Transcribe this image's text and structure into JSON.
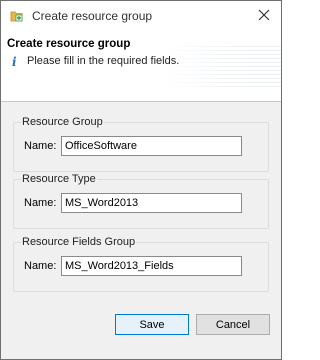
{
  "window": {
    "title": "Create resource group"
  },
  "header": {
    "title": "Create resource group",
    "message": "Please fill in the required fields.",
    "info_icon": "i"
  },
  "groups": [
    {
      "legend": "Resource Group",
      "name_label": "Name:",
      "value": "OfficeSoftware"
    },
    {
      "legend": "Resource Type",
      "name_label": "Name:",
      "value": "MS_Word2013"
    },
    {
      "legend": "Resource Fields Group",
      "name_label": "Name:",
      "value": "MS_Word2013_Fields"
    }
  ],
  "buttons": {
    "save_label": "Save",
    "cancel_label": "Cancel"
  },
  "colors": {
    "accent": "#0078d7",
    "info": "#2c6fb7",
    "app_icon_folder": "#e8b84a",
    "app_icon_plus": "#3aa04a"
  },
  "icons": {
    "app": "folder-add-icon",
    "close": "close-icon",
    "info": "info-icon"
  }
}
